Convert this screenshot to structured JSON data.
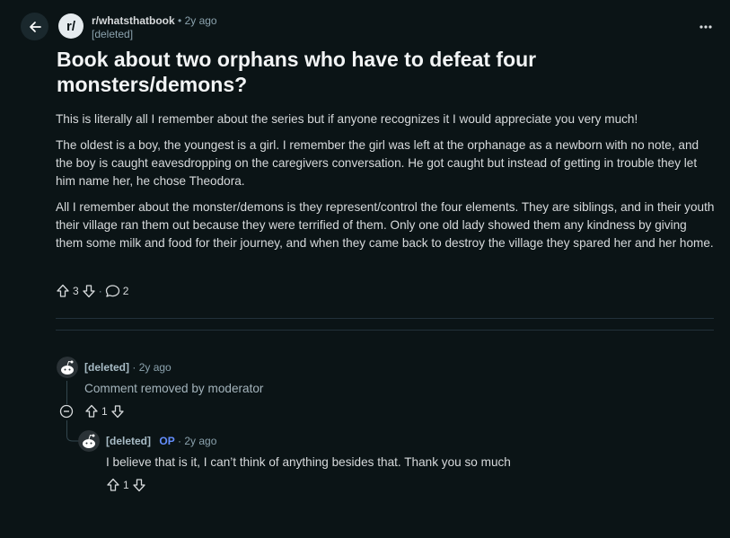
{
  "post": {
    "subreddit": "r/whatsthatbook",
    "subreddit_icon_text": "r/",
    "age": "2y ago",
    "author": "[deleted]",
    "title": "Book about two orphans who have to defeat four monsters/demons?",
    "body": [
      "This is literally all I remember about the series but if anyone recognizes it I would appreciate you very much!",
      "The oldest is a boy, the youngest is a girl. I remember the girl was left at the orphanage as a newborn with no note, and the boy is caught eavesdropping on the caregivers conversation. He got caught but instead of getting in trouble they let him name her, he chose Theodora.",
      "All I remember about the monster/demons is they represent/control the four elements. They are siblings, and in their youth their village ran them out because they were terrified of them. Only one old lady showed them any kindness by giving them some milk and food for their journey, and when they came back to destroy the village they spared her and her home."
    ],
    "upvotes": "3",
    "comment_count": "2",
    "dot_sep": "·"
  },
  "comments": [
    {
      "author": "[deleted]",
      "age": "· 2y ago",
      "text": "Comment removed by moderator",
      "score": "1"
    },
    {
      "author": "[deleted]",
      "op_badge": "OP",
      "age": "· 2y ago",
      "text": "I believe that is it, I can’t think of anything besides that. Thank you so much",
      "score": "1"
    }
  ],
  "icons": [
    "back-arrow-icon",
    "more-options-icon",
    "upvote-icon",
    "downvote-icon",
    "comment-bubble-icon",
    "collapse-thread-icon",
    "snoo-avatar-icon"
  ],
  "colors": {
    "background": "#0b1416",
    "op_badge": "#648efc",
    "text": "#d7dadc",
    "meta": "#8ba2ad"
  }
}
